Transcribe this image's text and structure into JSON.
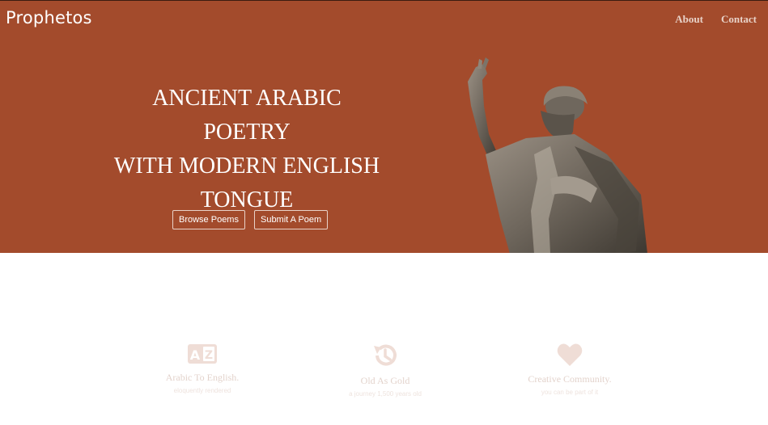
{
  "brand": "Prophetos",
  "nav": {
    "about": "About",
    "contact": "Contact"
  },
  "hero": {
    "headline_line1": "ANCIENT ARABIC POETRY",
    "headline_line2": "WITH MODERN ENGLISH",
    "headline_line3": "TONGUE",
    "browse_label": "Browse Poems",
    "submit_label": "Submit A Poem"
  },
  "features": [
    {
      "icon": "translate-az-icon",
      "title": "Arabic To English.",
      "subtitle": "eloquently rendered"
    },
    {
      "icon": "history-icon",
      "title": "Old As Gold",
      "subtitle": "a journey 1,500 years old"
    },
    {
      "icon": "heart-icon",
      "title": "Creative Community.",
      "subtitle": "you can be part of it"
    }
  ],
  "colors": {
    "hero_bg": "#a34b2c",
    "icon_tint": "#efddd6"
  }
}
